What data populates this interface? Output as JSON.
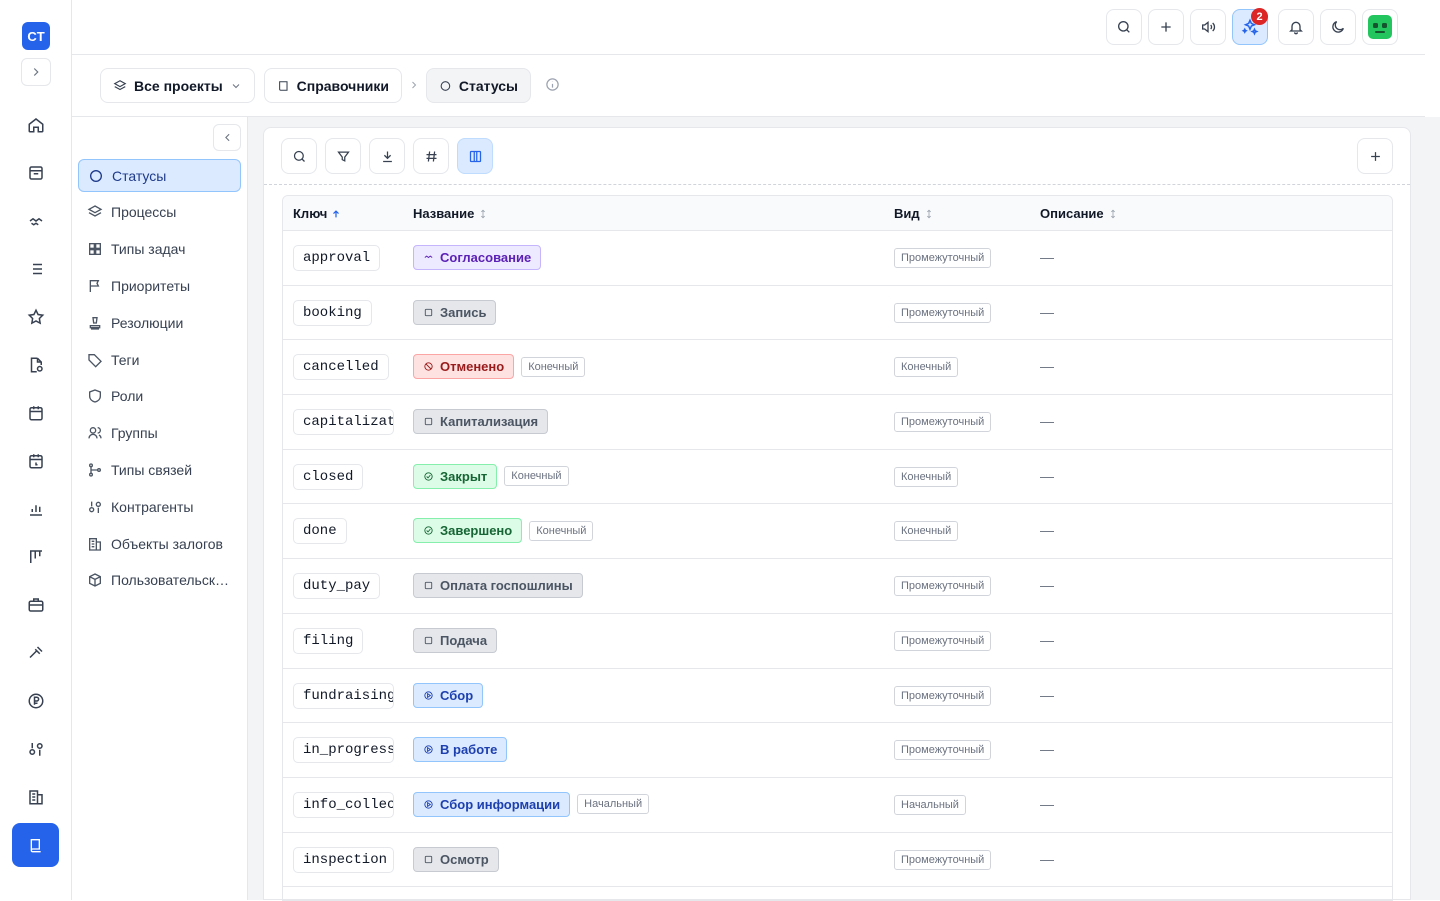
{
  "rail": {
    "logo": "CT"
  },
  "topbar": {
    "notifications_count": "2"
  },
  "breadcrumbs": {
    "projects": "Все проекты",
    "directories": "Справочники",
    "current": "Статусы"
  },
  "sidebar": {
    "items": [
      {
        "label": "Статусы",
        "icon": "circle-icon"
      },
      {
        "label": "Процессы",
        "icon": "layers-icon"
      },
      {
        "label": "Типы задач",
        "icon": "grid-icon"
      },
      {
        "label": "Приоритеты",
        "icon": "flag-icon"
      },
      {
        "label": "Резолюции",
        "icon": "stamp-icon"
      },
      {
        "label": "Теги",
        "icon": "tag-icon"
      },
      {
        "label": "Роли",
        "icon": "shield-icon"
      },
      {
        "label": "Группы",
        "icon": "users-icon"
      },
      {
        "label": "Типы связей",
        "icon": "git-branch-icon"
      },
      {
        "label": "Контрагенты",
        "icon": "partners-icon"
      },
      {
        "label": "Объекты залогов",
        "icon": "building-icon"
      },
      {
        "label": "Пользовательск…",
        "icon": "box-icon"
      }
    ]
  },
  "table": {
    "columns": {
      "key": "Ключ",
      "name": "Название",
      "kind": "Вид",
      "description": "Описание"
    },
    "rows": [
      {
        "key": "approval",
        "name": "Согласование",
        "color": "violet",
        "name_tag": "",
        "kind": "Промежуточный",
        "description": "—"
      },
      {
        "key": "booking",
        "name": "Запись",
        "color": "gray",
        "name_tag": "",
        "kind": "Промежуточный",
        "description": "—"
      },
      {
        "key": "cancelled",
        "name": "Отменено",
        "color": "red",
        "name_tag": "Конечный",
        "kind": "Конечный",
        "description": "—"
      },
      {
        "key": "capitalizati",
        "name": "Капитализация",
        "color": "gray",
        "name_tag": "",
        "kind": "Промежуточный",
        "description": "—"
      },
      {
        "key": "closed",
        "name": "Закрыт",
        "color": "green",
        "name_tag": "Конечный",
        "kind": "Конечный",
        "description": "—"
      },
      {
        "key": "done",
        "name": "Завершено",
        "color": "green",
        "name_tag": "Конечный",
        "kind": "Конечный",
        "description": "—"
      },
      {
        "key": "duty_pay",
        "name": "Оплата госпошлины",
        "color": "gray",
        "name_tag": "",
        "kind": "Промежуточный",
        "description": "—"
      },
      {
        "key": "filing",
        "name": "Подача",
        "color": "gray",
        "name_tag": "",
        "kind": "Промежуточный",
        "description": "—"
      },
      {
        "key": "fundraising",
        "name": "Сбор",
        "color": "blue",
        "name_tag": "",
        "kind": "Промежуточный",
        "description": "—"
      },
      {
        "key": "in_progress",
        "name": "В работе",
        "color": "blue",
        "name_tag": "",
        "kind": "Промежуточный",
        "description": "—"
      },
      {
        "key": "info_collect",
        "name": "Сбор информации",
        "color": "blue",
        "name_tag": "Начальный",
        "kind": "Начальный",
        "description": "—"
      },
      {
        "key": "inspection",
        "name": "Осмотр",
        "color": "gray",
        "name_tag": "",
        "kind": "Промежуточный",
        "description": "—"
      },
      {
        "key": "",
        "name": "",
        "color": "gray",
        "name_tag": "",
        "kind": "",
        "description": ""
      }
    ]
  }
}
